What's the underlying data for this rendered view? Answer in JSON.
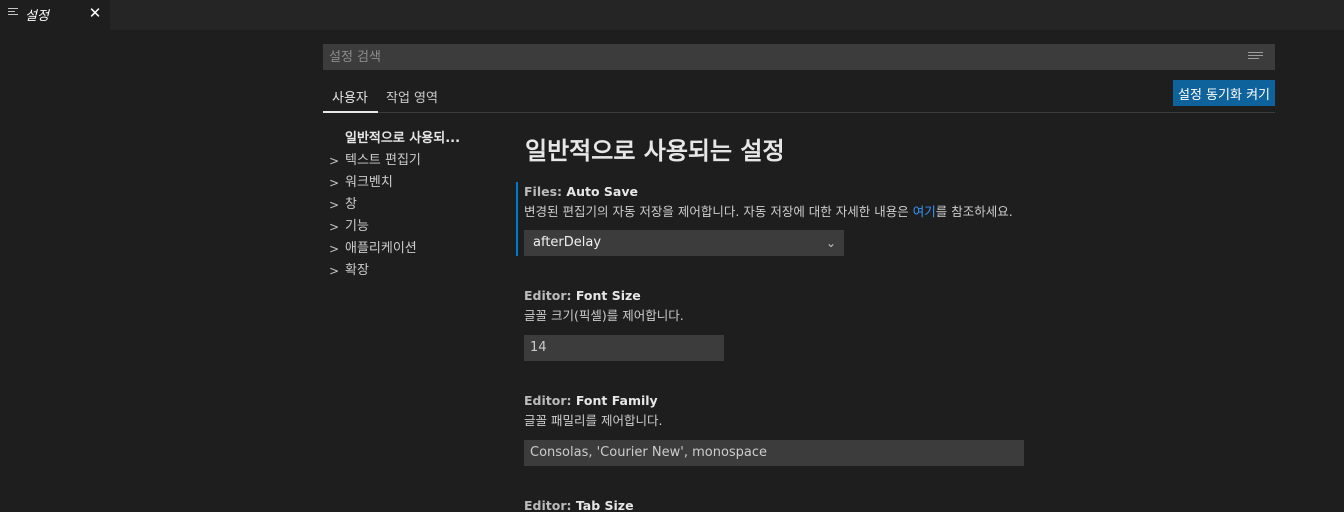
{
  "tab": {
    "title": "설정",
    "close_glyph": "✕",
    "icon": "settings-file-icon"
  },
  "search": {
    "placeholder": "설정 검색",
    "filter_icon": "filter-list-icon"
  },
  "scope_tabs": [
    {
      "label": "사용자",
      "active": true
    },
    {
      "label": "작업 영역",
      "active": false
    }
  ],
  "sync_button": {
    "label": "설정 동기화 켜기"
  },
  "toc": {
    "items": [
      {
        "label": "일반적으로 사용되...",
        "active": true
      },
      {
        "label": "텍스트 편집기",
        "expandable": true
      },
      {
        "label": "워크벤치",
        "expandable": true
      },
      {
        "label": "창",
        "expandable": true
      },
      {
        "label": "기능",
        "expandable": true
      },
      {
        "label": "애플리케이션",
        "expandable": true
      },
      {
        "label": "확장",
        "expandable": true
      }
    ]
  },
  "section_title": "일반적으로 사용되는 설정",
  "settings": [
    {
      "category": "Files: ",
      "name": "Auto Save",
      "description_before": "변경된 편집기의 자동 저장을 제어합니다. 자동 저장에 대한 자세한 내용은 ",
      "link_text": "여기",
      "description_after": "를 참조하세요.",
      "value": "afterDelay"
    },
    {
      "category": "Editor: ",
      "name": "Font Size",
      "description": "글꼴 크기(픽셀)를 제어합니다.",
      "value": "14"
    },
    {
      "category": "Editor: ",
      "name": "Font Family",
      "description": "글꼴 패밀리를 제어합니다.",
      "value": "Consolas, 'Courier New', monospace"
    },
    {
      "category": "Editor: ",
      "name": "Tab Size"
    }
  ],
  "colors": {
    "background": "#1e1e1e",
    "accent": "#007acc",
    "button": "#0e639c",
    "link": "#3794ff"
  }
}
